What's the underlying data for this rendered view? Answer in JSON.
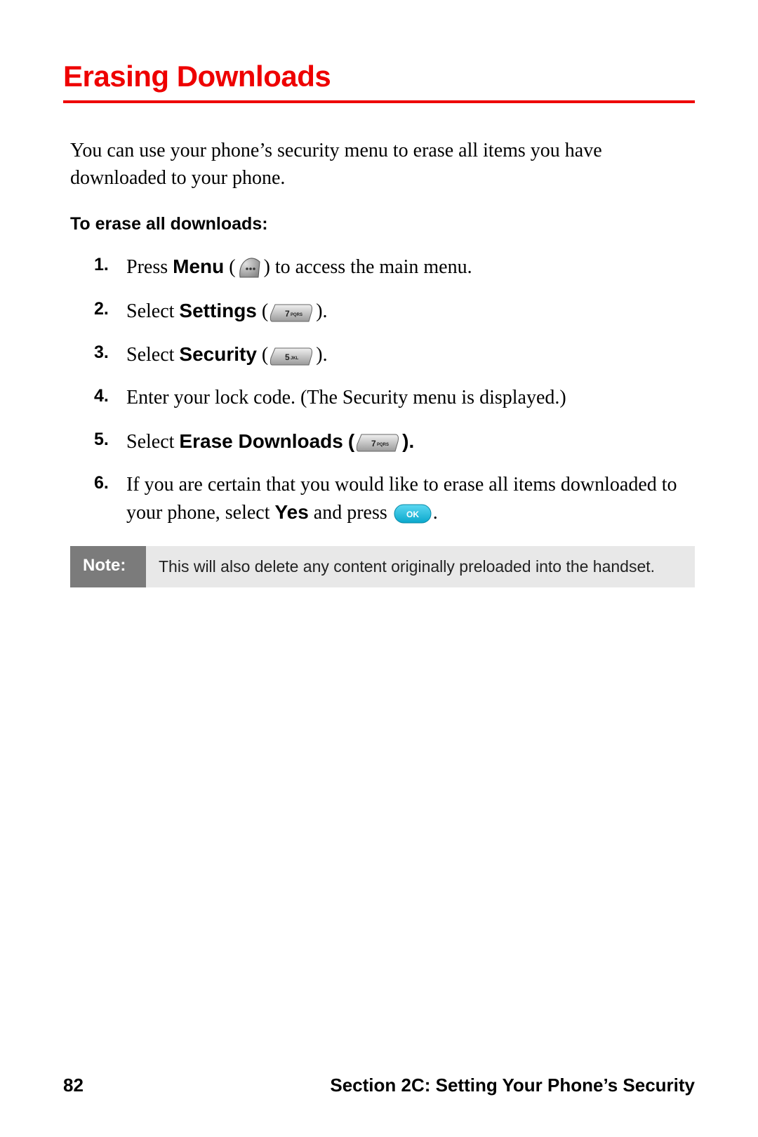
{
  "title": "Erasing Downloads",
  "intro": "You can use your phone’s security menu to erase all items you have downloaded to your phone.",
  "subhead": "To erase all downloads:",
  "steps": {
    "s1_pre": "Press ",
    "s1_bold": "Menu",
    "s1_post": " to access the main menu.",
    "s2_pre": "Select ",
    "s2_bold": "Settings",
    "s3_pre": "Select ",
    "s3_bold": "Security",
    "s4": "Enter your lock code. (The Security menu is displayed.)",
    "s5_pre": "Select ",
    "s5_bold": "Erase Downloads",
    "s6_a": "If you are certain that you would like to erase all items downloaded to your phone, select ",
    "s6_bold": "Yes",
    "s6_b": " and press ",
    "s6_c": "."
  },
  "key_labels": {
    "seven": "7 PQRS",
    "five": "5 JKL"
  },
  "ok_label": "OK",
  "note": {
    "label": "Note:",
    "body": "This will also delete any content originally preloaded into the handset."
  },
  "footer": {
    "page": "82",
    "section": "Section 2C: Setting Your Phone’s Security"
  }
}
